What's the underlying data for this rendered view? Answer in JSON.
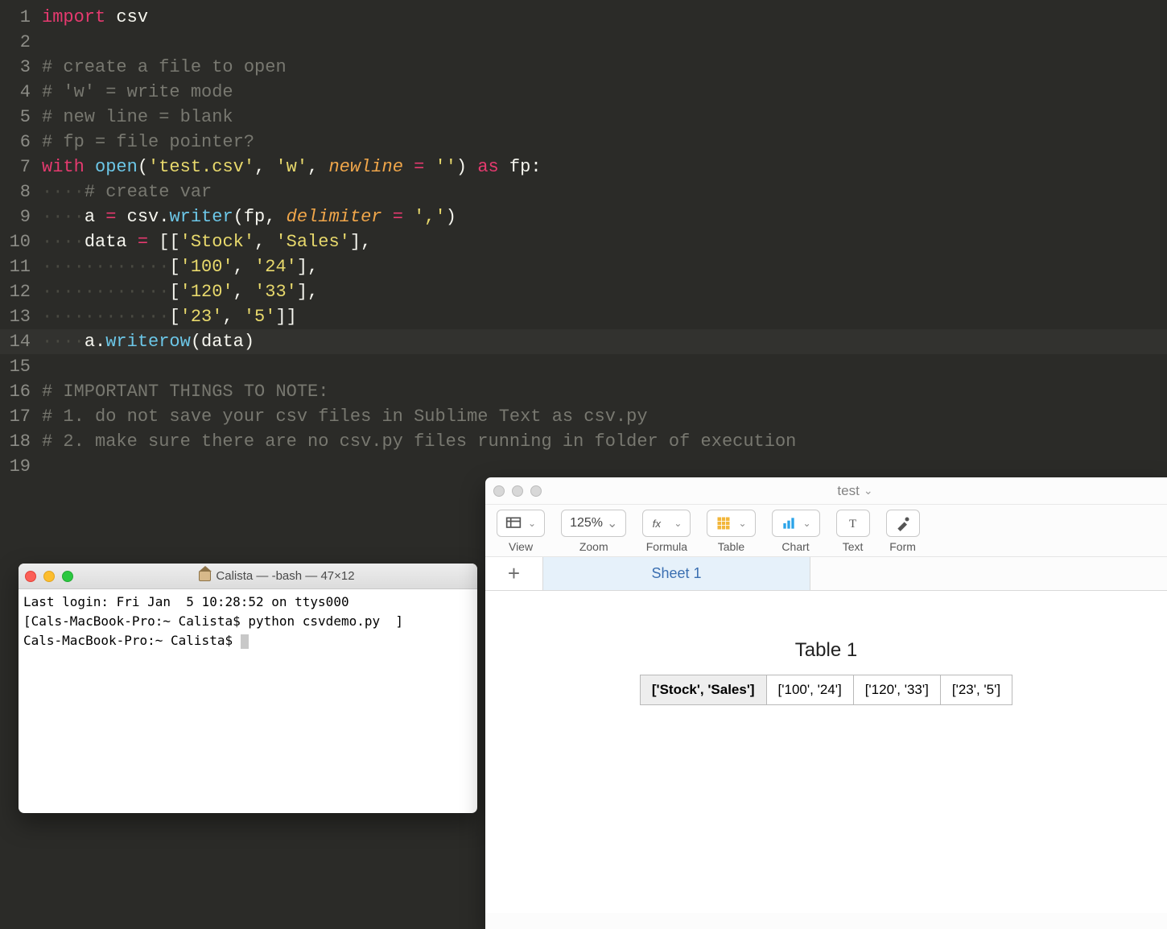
{
  "editor": {
    "lines": [
      {
        "n": "1",
        "hl": false,
        "tokens": [
          [
            "kw",
            "import"
          ],
          [
            "wht",
            " csv"
          ]
        ]
      },
      {
        "n": "2",
        "hl": false,
        "tokens": []
      },
      {
        "n": "3",
        "hl": false,
        "tokens": [
          [
            "cmt",
            "# create a file to open"
          ]
        ]
      },
      {
        "n": "4",
        "hl": false,
        "tokens": [
          [
            "cmt",
            "# 'w' = write mode"
          ]
        ]
      },
      {
        "n": "5",
        "hl": false,
        "tokens": [
          [
            "cmt",
            "# new line = blank"
          ]
        ]
      },
      {
        "n": "6",
        "hl": false,
        "tokens": [
          [
            "cmt",
            "# fp = file pointer?"
          ]
        ]
      },
      {
        "n": "7",
        "hl": false,
        "tokens": [
          [
            "kw",
            "with"
          ],
          [
            "wht",
            " "
          ],
          [
            "fn",
            "open"
          ],
          [
            "wht",
            "("
          ],
          [
            "str",
            "'test.csv'"
          ],
          [
            "wht",
            ", "
          ],
          [
            "str",
            "'w'"
          ],
          [
            "wht",
            ", "
          ],
          [
            "arg",
            "newline"
          ],
          [
            "wht",
            " "
          ],
          [
            "op",
            "="
          ],
          [
            "wht",
            " "
          ],
          [
            "str",
            "''"
          ],
          [
            "wht",
            ") "
          ],
          [
            "kw",
            "as"
          ],
          [
            "wht",
            " fp:"
          ]
        ]
      },
      {
        "n": "8",
        "hl": false,
        "tokens": [
          [
            "indent",
            "····"
          ],
          [
            "cmt",
            "# create var"
          ]
        ]
      },
      {
        "n": "9",
        "hl": false,
        "tokens": [
          [
            "indent",
            "····"
          ],
          [
            "wht",
            "a "
          ],
          [
            "op",
            "="
          ],
          [
            "wht",
            " csv."
          ],
          [
            "fn",
            "writer"
          ],
          [
            "wht",
            "(fp, "
          ],
          [
            "arg",
            "delimiter"
          ],
          [
            "wht",
            " "
          ],
          [
            "op",
            "="
          ],
          [
            "wht",
            " "
          ],
          [
            "str",
            "','"
          ],
          [
            "wht",
            ")"
          ]
        ]
      },
      {
        "n": "10",
        "hl": false,
        "tokens": [
          [
            "indent",
            "····"
          ],
          [
            "wht",
            "data "
          ],
          [
            "op",
            "="
          ],
          [
            "wht",
            " [["
          ],
          [
            "str",
            "'Stock'"
          ],
          [
            "wht",
            ", "
          ],
          [
            "str",
            "'Sales'"
          ],
          [
            "wht",
            "],"
          ]
        ]
      },
      {
        "n": "11",
        "hl": false,
        "tokens": [
          [
            "indent",
            "············"
          ],
          [
            "wht",
            "["
          ],
          [
            "str",
            "'100'"
          ],
          [
            "wht",
            ", "
          ],
          [
            "str",
            "'24'"
          ],
          [
            "wht",
            "],"
          ]
        ]
      },
      {
        "n": "12",
        "hl": false,
        "tokens": [
          [
            "indent",
            "············"
          ],
          [
            "wht",
            "["
          ],
          [
            "str",
            "'120'"
          ],
          [
            "wht",
            ", "
          ],
          [
            "str",
            "'33'"
          ],
          [
            "wht",
            "],"
          ]
        ]
      },
      {
        "n": "13",
        "hl": false,
        "tokens": [
          [
            "indent",
            "············"
          ],
          [
            "wht",
            "["
          ],
          [
            "str",
            "'23'"
          ],
          [
            "wht",
            ", "
          ],
          [
            "str",
            "'5'"
          ],
          [
            "wht",
            "]]"
          ]
        ]
      },
      {
        "n": "14",
        "hl": true,
        "tokens": [
          [
            "indent",
            "····"
          ],
          [
            "wht",
            "a."
          ],
          [
            "fn",
            "writerow"
          ],
          [
            "wht",
            "(data)"
          ]
        ]
      },
      {
        "n": "15",
        "hl": false,
        "tokens": []
      },
      {
        "n": "16",
        "hl": false,
        "tokens": [
          [
            "cmt",
            "# IMPORTANT THINGS TO NOTE:"
          ]
        ]
      },
      {
        "n": "17",
        "hl": false,
        "tokens": [
          [
            "cmt",
            "# 1. do not save your csv files in Sublime Text as csv.py"
          ]
        ]
      },
      {
        "n": "18",
        "hl": false,
        "tokens": [
          [
            "cmt",
            "# 2. make sure there are no csv.py files running in folder of execution"
          ]
        ]
      },
      {
        "n": "19",
        "hl": false,
        "tokens": []
      }
    ]
  },
  "terminal": {
    "title": "Calista — -bash — 47×12",
    "lines": [
      "Last login: Fri Jan  5 10:28:52 on ttys000",
      "[Cals-MacBook-Pro:~ Calista$ python csvdemo.py  ]",
      "Cals-MacBook-Pro:~ Calista$ "
    ]
  },
  "numbers": {
    "doc_title": "test",
    "toolbar": [
      {
        "icon": "view",
        "label": "View",
        "text": ""
      },
      {
        "icon": "zoom",
        "label": "Zoom",
        "text": "125%"
      },
      {
        "icon": "formula",
        "label": "Formula",
        "text": ""
      },
      {
        "icon": "table",
        "label": "Table",
        "text": ""
      },
      {
        "icon": "chart",
        "label": "Chart",
        "text": ""
      },
      {
        "icon": "text",
        "label": "Text",
        "text": ""
      },
      {
        "icon": "format",
        "label": "Form",
        "text": ""
      }
    ],
    "sheet_tab": "Sheet 1",
    "table_title": "Table 1",
    "cells": [
      "['Stock', 'Sales']",
      "['100', '24']",
      "['120', '33']",
      "['23', '5']"
    ]
  }
}
